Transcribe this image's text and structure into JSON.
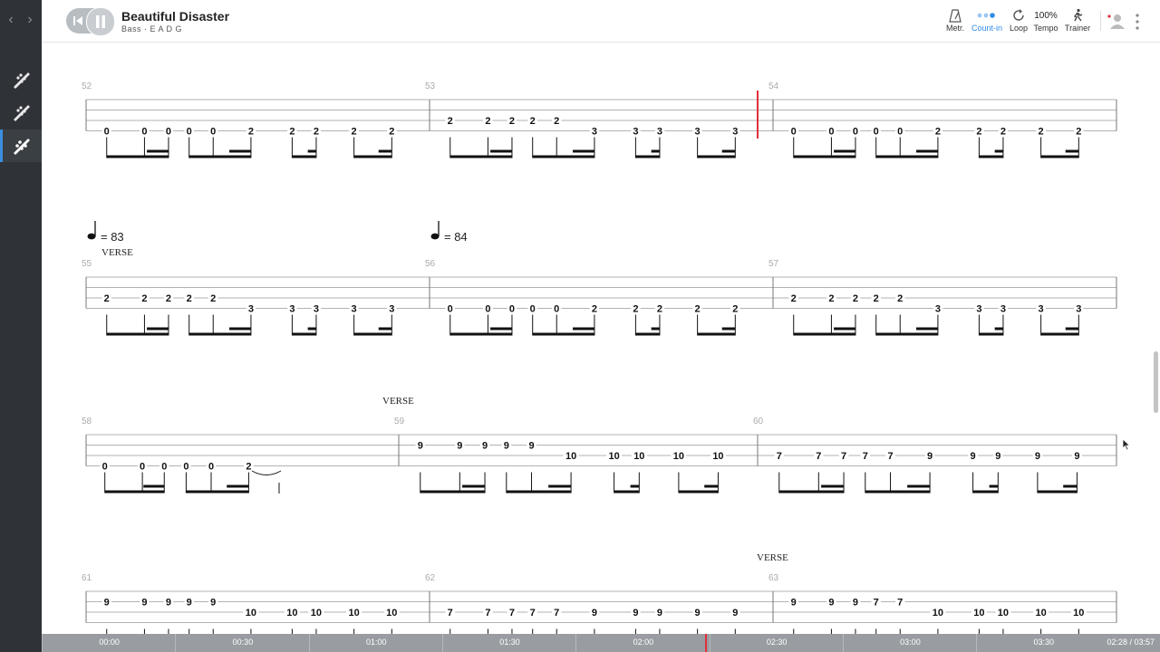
{
  "nav": {
    "back": "‹",
    "forward": "›"
  },
  "song": {
    "title": "Beautiful Disaster",
    "subtitle": "Bass · E A D G"
  },
  "toolbar": {
    "metronome": "Metr.",
    "countin": "Count-in",
    "loop": "Loop",
    "tempo_value": "100%",
    "tempo": "Tempo",
    "trainer": "Trainer"
  },
  "colors": {
    "accent": "#2f8be6",
    "playhead": "#e0303a",
    "sidebar": "#2f3337"
  },
  "score": {
    "systems": [
      {
        "measures": [
          {
            "number": "52",
            "events": [
              {
                "s": 3,
                "f": "0"
              },
              {
                "s": 3,
                "f": "0"
              },
              {
                "s": 3,
                "f": "0"
              },
              {
                "s": 3,
                "f": "0"
              },
              {
                "s": 3,
                "f": "0"
              },
              {
                "s": 3,
                "f": "2"
              },
              {
                "s": 3,
                "f": "2"
              },
              {
                "s": 3,
                "f": "2"
              },
              {
                "s": 3,
                "f": "2"
              },
              {
                "s": 3,
                "f": "2"
              }
            ]
          },
          {
            "number": "53",
            "events": [
              {
                "s": 2,
                "f": "2"
              },
              {
                "s": 2,
                "f": "2"
              },
              {
                "s": 2,
                "f": "2"
              },
              {
                "s": 2,
                "f": "2"
              },
              {
                "s": 2,
                "f": "2"
              },
              {
                "s": 3,
                "f": "3"
              },
              {
                "s": 3,
                "f": "3"
              },
              {
                "s": 3,
                "f": "3"
              },
              {
                "s": 3,
                "f": "3"
              },
              {
                "s": 3,
                "f": "3"
              }
            ]
          },
          {
            "number": "54",
            "events": [
              {
                "s": 3,
                "f": "0"
              },
              {
                "s": 3,
                "f": "0"
              },
              {
                "s": 3,
                "f": "0"
              },
              {
                "s": 3,
                "f": "0"
              },
              {
                "s": 3,
                "f": "0"
              },
              {
                "s": 3,
                "f": "2"
              },
              {
                "s": 3,
                "f": "2"
              },
              {
                "s": 3,
                "f": "2"
              },
              {
                "s": 3,
                "f": "2"
              },
              {
                "s": 3,
                "f": "2"
              }
            ]
          }
        ]
      },
      {
        "tempos": [
          {
            "measure": 0,
            "bpm": "= 83"
          },
          {
            "measure": 1,
            "bpm": "= 84"
          }
        ],
        "sections": [
          {
            "measure": 0,
            "text": "VERSE"
          }
        ],
        "measures": [
          {
            "number": "55",
            "events": [
              {
                "s": 2,
                "f": "2"
              },
              {
                "s": 2,
                "f": "2"
              },
              {
                "s": 2,
                "f": "2"
              },
              {
                "s": 2,
                "f": "2"
              },
              {
                "s": 2,
                "f": "2"
              },
              {
                "s": 3,
                "f": "3"
              },
              {
                "s": 3,
                "f": "3"
              },
              {
                "s": 3,
                "f": "3"
              },
              {
                "s": 3,
                "f": "3"
              },
              {
                "s": 3,
                "f": "3"
              }
            ]
          },
          {
            "number": "56",
            "events": [
              {
                "s": 3,
                "f": "0"
              },
              {
                "s": 3,
                "f": "0"
              },
              {
                "s": 3,
                "f": "0"
              },
              {
                "s": 3,
                "f": "0"
              },
              {
                "s": 3,
                "f": "0"
              },
              {
                "s": 3,
                "f": "2"
              },
              {
                "s": 3,
                "f": "2"
              },
              {
                "s": 3,
                "f": "2"
              },
              {
                "s": 3,
                "f": "2"
              },
              {
                "s": 3,
                "f": "2"
              }
            ]
          },
          {
            "number": "57",
            "events": [
              {
                "s": 2,
                "f": "2"
              },
              {
                "s": 2,
                "f": "2"
              },
              {
                "s": 2,
                "f": "2"
              },
              {
                "s": 2,
                "f": "2"
              },
              {
                "s": 2,
                "f": "2"
              },
              {
                "s": 3,
                "f": "3"
              },
              {
                "s": 3,
                "f": "3"
              },
              {
                "s": 3,
                "f": "3"
              },
              {
                "s": 3,
                "f": "3"
              },
              {
                "s": 3,
                "f": "3"
              }
            ]
          }
        ]
      },
      {
        "sections": [
          {
            "measure": 1,
            "text": "VERSE"
          }
        ],
        "measures": [
          {
            "number": "58",
            "events": [
              {
                "s": 3,
                "f": "0"
              },
              {
                "s": 3,
                "f": "0"
              },
              {
                "s": 3,
                "f": "0"
              },
              {
                "s": 3,
                "f": "0"
              },
              {
                "s": 3,
                "f": "0"
              },
              {
                "s": 3,
                "f": "2"
              }
            ]
          },
          {
            "number": "59",
            "events": [
              {
                "s": 1,
                "f": "9"
              },
              {
                "s": 1,
                "f": "9"
              },
              {
                "s": 1,
                "f": "9"
              },
              {
                "s": 1,
                "f": "9"
              },
              {
                "s": 1,
                "f": "9"
              },
              {
                "s": 2,
                "f": "10"
              },
              {
                "s": 2,
                "f": "10"
              },
              {
                "s": 2,
                "f": "10"
              },
              {
                "s": 2,
                "f": "10"
              },
              {
                "s": 2,
                "f": "10"
              }
            ]
          },
          {
            "number": "60",
            "events": [
              {
                "s": 2,
                "f": "7"
              },
              {
                "s": 2,
                "f": "7"
              },
              {
                "s": 2,
                "f": "7"
              },
              {
                "s": 2,
                "f": "7"
              },
              {
                "s": 2,
                "f": "7"
              },
              {
                "s": 2,
                "f": "9"
              },
              {
                "s": 2,
                "f": "9"
              },
              {
                "s": 2,
                "f": "9"
              },
              {
                "s": 2,
                "f": "9"
              },
              {
                "s": 2,
                "f": "9"
              }
            ]
          }
        ]
      },
      {
        "sections": [
          {
            "measure": 2,
            "text": "VERSE"
          }
        ],
        "measures": [
          {
            "number": "61",
            "events": [
              {
                "s": 1,
                "f": "9"
              },
              {
                "s": 1,
                "f": "9"
              },
              {
                "s": 1,
                "f": "9"
              },
              {
                "s": 1,
                "f": "9"
              },
              {
                "s": 1,
                "f": "9"
              },
              {
                "s": 2,
                "f": "10"
              },
              {
                "s": 2,
                "f": "10"
              },
              {
                "s": 2,
                "f": "10"
              },
              {
                "s": 2,
                "f": "10"
              },
              {
                "s": 2,
                "f": "10"
              }
            ]
          },
          {
            "number": "62",
            "events": [
              {
                "s": 2,
                "f": "7"
              },
              {
                "s": 2,
                "f": "7"
              },
              {
                "s": 2,
                "f": "7"
              },
              {
                "s": 2,
                "f": "7"
              },
              {
                "s": 2,
                "f": "7"
              },
              {
                "s": 2,
                "f": "9"
              },
              {
                "s": 2,
                "f": "9"
              },
              {
                "s": 2,
                "f": "9"
              },
              {
                "s": 2,
                "f": "9"
              },
              {
                "s": 2,
                "f": "9"
              }
            ]
          },
          {
            "number": "63",
            "events": [
              {
                "s": 1,
                "f": "9"
              },
              {
                "s": 1,
                "f": "9"
              },
              {
                "s": 1,
                "f": "9"
              },
              {
                "s": 1,
                "f": "7"
              },
              {
                "s": 1,
                "f": "7"
              },
              {
                "s": 2,
                "f": "10"
              },
              {
                "s": 2,
                "f": "10"
              },
              {
                "s": 2,
                "f": "10"
              },
              {
                "s": 2,
                "f": "10"
              },
              {
                "s": 2,
                "f": "10"
              }
            ]
          }
        ]
      }
    ]
  },
  "timeline": {
    "labels": [
      "00:00",
      "00:30",
      "01:00",
      "01:30",
      "02:00",
      "02:30",
      "03:00",
      "03:30"
    ],
    "time": "02:28 / 03:57",
    "progress": 0.62
  }
}
